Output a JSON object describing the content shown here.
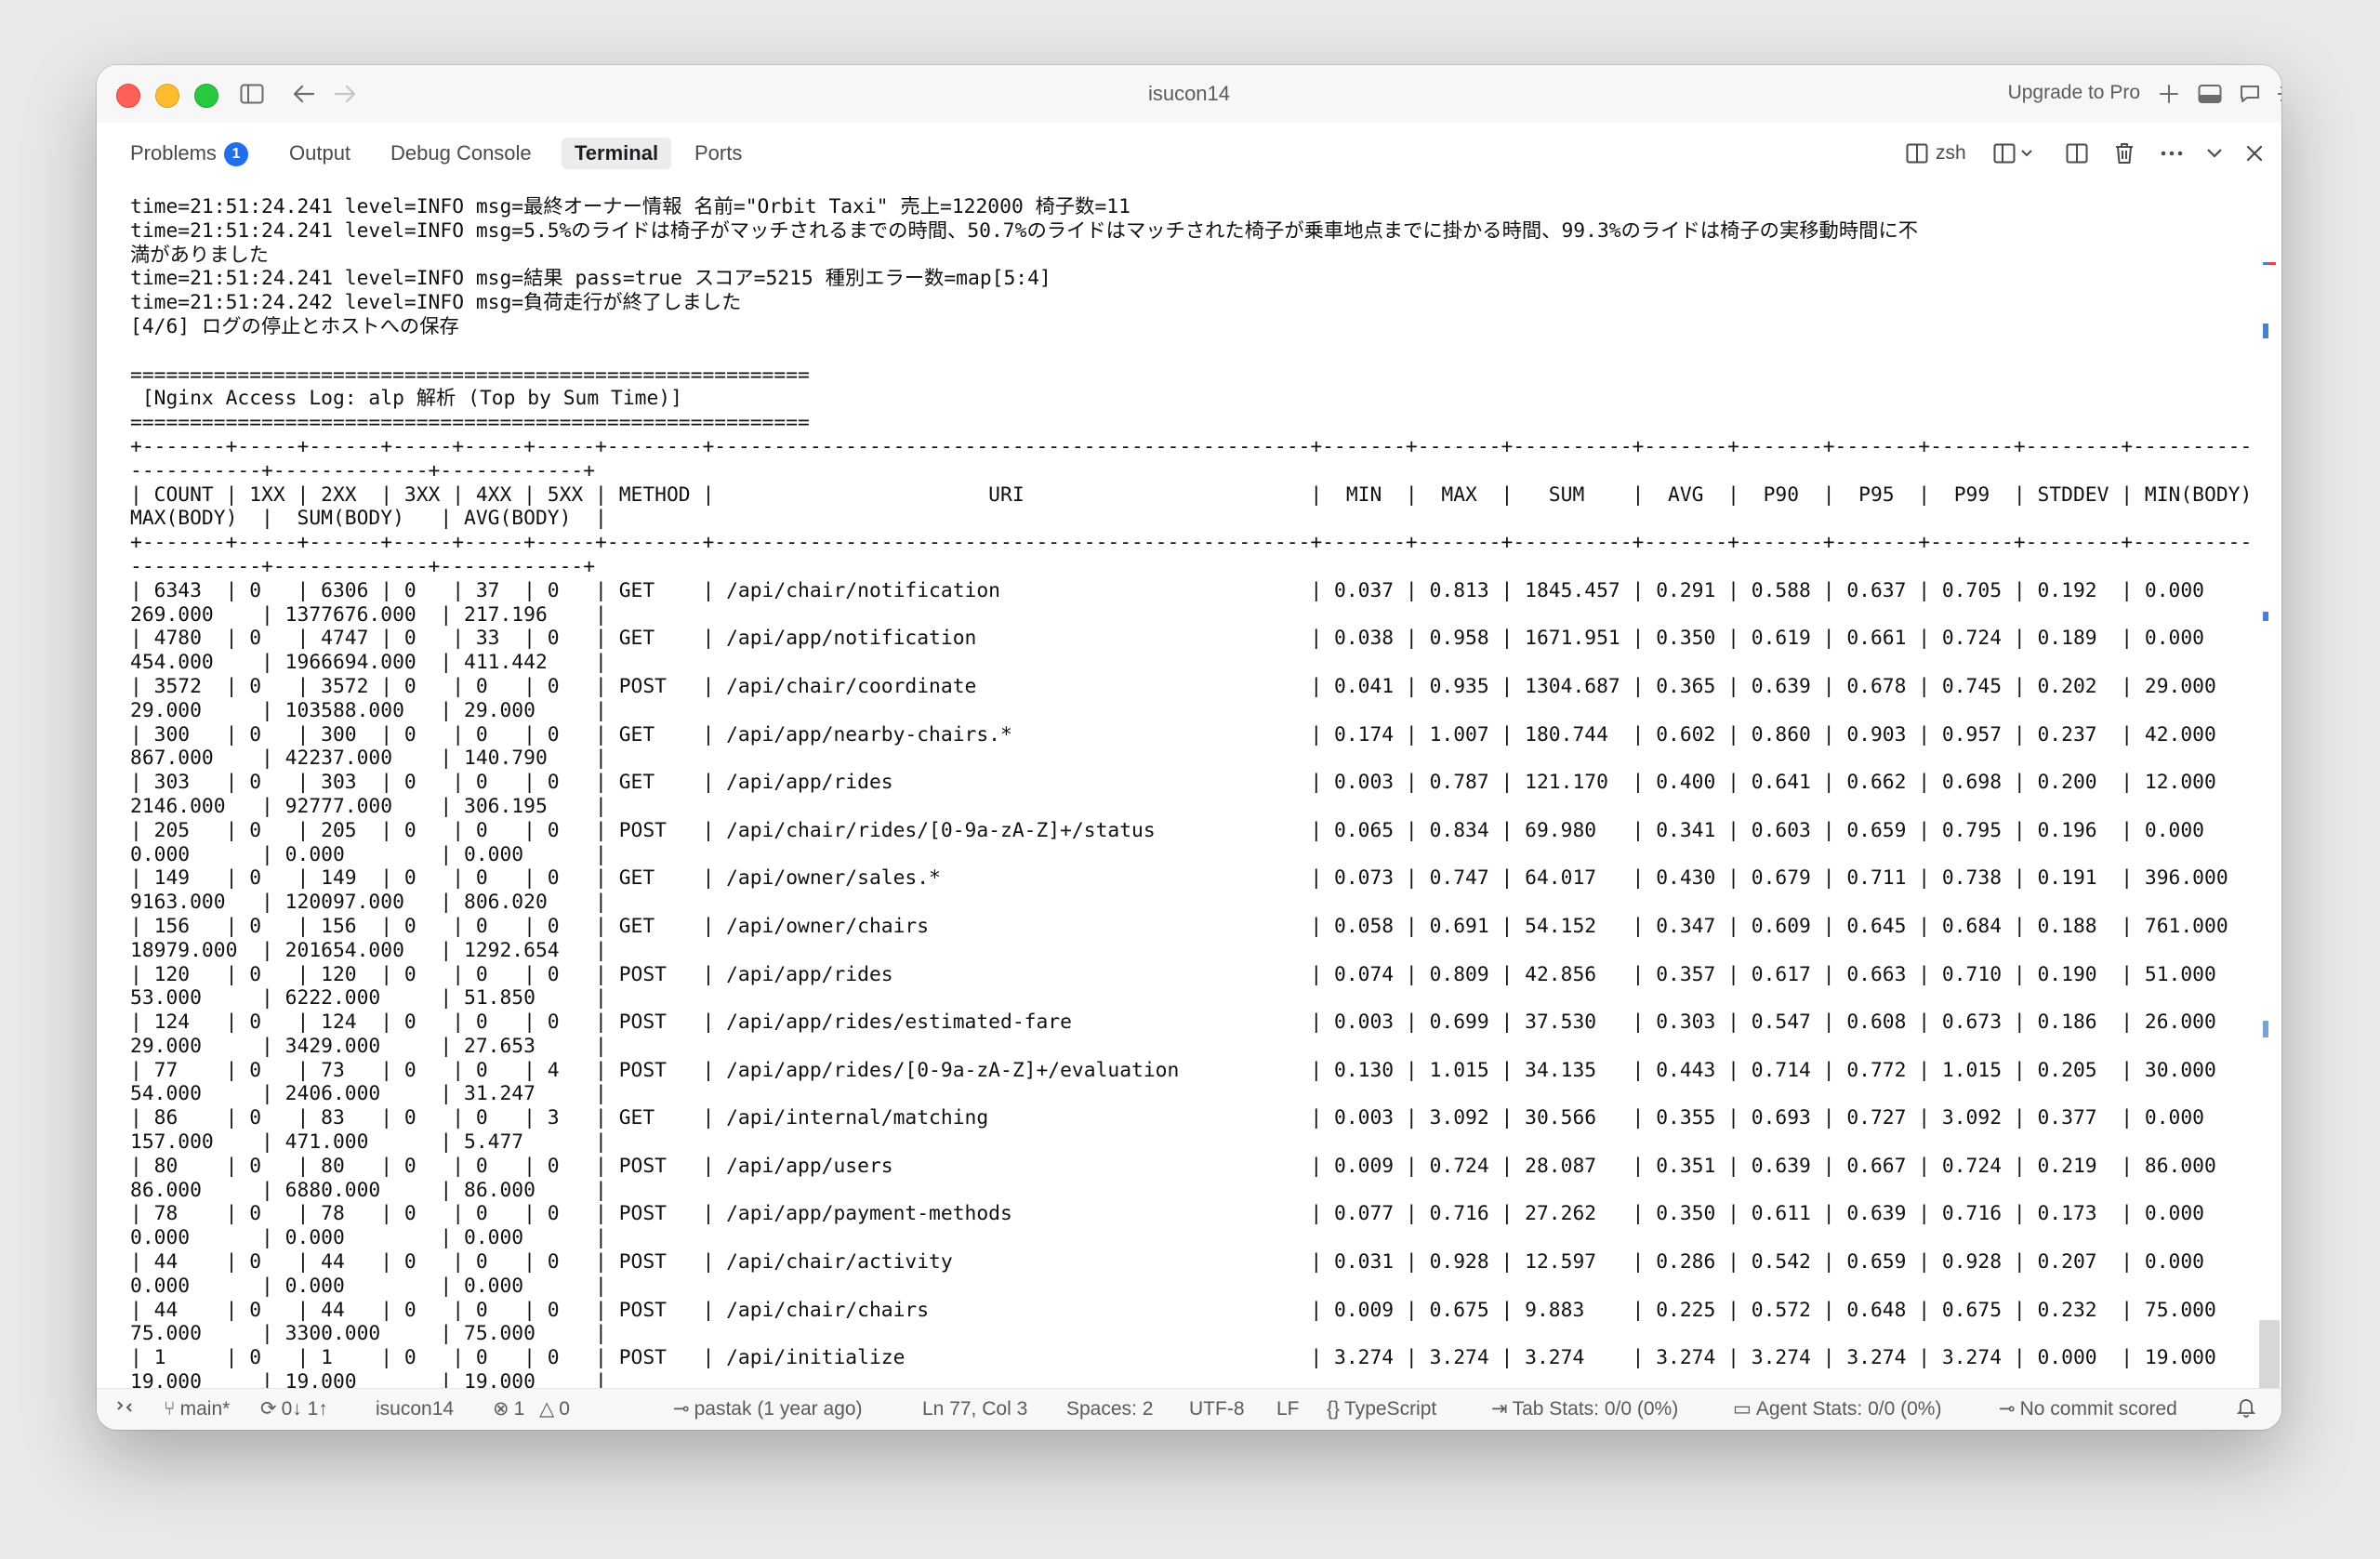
{
  "window": {
    "title": "isucon14",
    "upgrade_label": "Upgrade to Pro"
  },
  "panel": {
    "tabs": [
      {
        "label": "Problems",
        "badge": "1"
      },
      {
        "label": "Output"
      },
      {
        "label": "Debug Console"
      },
      {
        "label": "Terminal",
        "active": true
      },
      {
        "label": "Ports"
      }
    ],
    "shell_label": "zsh"
  },
  "terminal": {
    "lines": [
      "time=21:51:24.241 level=INFO msg=最終オーナー情報 名前=\"Orbit Taxi\" 売上=122000 椅子数=11",
      "time=21:51:24.241 level=INFO msg=5.5%のライドは椅子がマッチされるまでの時間、50.7%のライドはマッチされた椅子が乗車地点までに掛かる時間、99.3%のライドは椅子の実移動時間に不",
      "満がありました",
      "time=21:51:24.241 level=INFO msg=結果 pass=true スコア=5215 種別エラー数=map[5:4]",
      "time=21:51:24.242 level=INFO msg=負荷走行が終了しました",
      "[4/6] ログの停止とホストへの保存",
      "",
      "=========================================================",
      " [Nginx Access Log: alp 解析 (Top by Sum Time)]",
      "=========================================================",
      "+-------+-----+------+-----+-----+-----+--------+--------------------------------------------------+-------+-------+----------+-------+-------+-------+-------+--------+-----------+-",
      "-----------+-------------+------------+",
      "| COUNT | 1XX | 2XX  | 3XX | 4XX | 5XX | METHOD |                       URI                        |  MIN  |  MAX  |   SUM    |  AVG  |  P90  |  P95  |  P99  | STDDEV | MIN(BODY) |",
      "MAX(BODY)  |  SUM(BODY)   | AVG(BODY)  |",
      "+-------+-----+------+-----+-----+-----+--------+--------------------------------------------------+-------+-------+----------+-------+-------+-------+-------+--------+-----------+-",
      "-----------+-------------+------------+",
      "| 6343  | 0   | 6306 | 0   | 37  | 0   | GET    | /api/chair/notification                          | 0.037 | 0.813 | 1845.457 | 0.291 | 0.588 | 0.637 | 0.705 | 0.192  | 0.000     |",
      "269.000    | 1377676.000  | 217.196    |",
      "| 4780  | 0   | 4747 | 0   | 33  | 0   | GET    | /api/app/notification                            | 0.038 | 0.958 | 1671.951 | 0.350 | 0.619 | 0.661 | 0.724 | 0.189  | 0.000     |",
      "454.000    | 1966694.000  | 411.442    |",
      "| 3572  | 0   | 3572 | 0   | 0   | 0   | POST   | /api/chair/coordinate                            | 0.041 | 0.935 | 1304.687 | 0.365 | 0.639 | 0.678 | 0.745 | 0.202  | 29.000    |",
      "29.000     | 103588.000   | 29.000     |",
      "| 300   | 0   | 300  | 0   | 0   | 0   | GET    | /api/app/nearby-chairs.*                         | 0.174 | 1.007 | 180.744  | 0.602 | 0.860 | 0.903 | 0.957 | 0.237  | 42.000    |",
      "867.000    | 42237.000    | 140.790    |",
      "| 303   | 0   | 303  | 0   | 0   | 0   | GET    | /api/app/rides                                   | 0.003 | 0.787 | 121.170  | 0.400 | 0.641 | 0.662 | 0.698 | 0.200  | 12.000    |",
      "2146.000   | 92777.000    | 306.195    |",
      "| 205   | 0   | 205  | 0   | 0   | 0   | POST   | /api/chair/rides/[0-9a-zA-Z]+/status             | 0.065 | 0.834 | 69.980   | 0.341 | 0.603 | 0.659 | 0.795 | 0.196  | 0.000     |",
      "0.000      | 0.000        | 0.000      |",
      "| 149   | 0   | 149  | 0   | 0   | 0   | GET    | /api/owner/sales.*                               | 0.073 | 0.747 | 64.017   | 0.430 | 0.679 | 0.711 | 0.738 | 0.191  | 396.000   |",
      "9163.000   | 120097.000   | 806.020    |",
      "| 156   | 0   | 156  | 0   | 0   | 0   | GET    | /api/owner/chairs                                | 0.058 | 0.691 | 54.152   | 0.347 | 0.609 | 0.645 | 0.684 | 0.188  | 761.000   |",
      "18979.000  | 201654.000   | 1292.654   |",
      "| 120   | 0   | 120  | 0   | 0   | 0   | POST   | /api/app/rides                                   | 0.074 | 0.809 | 42.856   | 0.357 | 0.617 | 0.663 | 0.710 | 0.190  | 51.000    |",
      "53.000     | 6222.000     | 51.850     |",
      "| 124   | 0   | 124  | 0   | 0   | 0   | POST   | /api/app/rides/estimated-fare                    | 0.003 | 0.699 | 37.530   | 0.303 | 0.547 | 0.608 | 0.673 | 0.186  | 26.000    |",
      "29.000     | 3429.000     | 27.653     |",
      "| 77    | 0   | 73   | 0   | 0   | 4   | POST   | /api/app/rides/[0-9a-zA-Z]+/evaluation           | 0.130 | 1.015 | 34.135   | 0.443 | 0.714 | 0.772 | 1.015 | 0.205  | 30.000    |",
      "54.000     | 2406.000     | 31.247     |",
      "| 86    | 0   | 83   | 0   | 0   | 3   | GET    | /api/internal/matching                           | 0.003 | 3.092 | 30.566   | 0.355 | 0.693 | 0.727 | 3.092 | 0.377  | 0.000     |",
      "157.000    | 471.000      | 5.477      |",
      "| 80    | 0   | 80   | 0   | 0   | 0   | POST   | /api/app/users                                   | 0.009 | 0.724 | 28.087   | 0.351 | 0.639 | 0.667 | 0.724 | 0.219  | 86.000    |",
      "86.000     | 6880.000     | 86.000     |",
      "| 78    | 0   | 78   | 0   | 0   | 0   | POST   | /api/app/payment-methods                         | 0.077 | 0.716 | 27.262   | 0.350 | 0.611 | 0.639 | 0.716 | 0.173  | 0.000     |",
      "0.000      | 0.000        | 0.000      |",
      "| 44    | 0   | 44   | 0   | 0   | 0   | POST   | /api/chair/activity                              | 0.031 | 0.928 | 12.597   | 0.286 | 0.542 | 0.659 | 0.928 | 0.207  | 0.000     |",
      "0.000      | 0.000        | 0.000      |",
      "| 44    | 0   | 44   | 0   | 0   | 0   | POST   | /api/chair/chairs                                | 0.009 | 0.675 | 9.883    | 0.225 | 0.572 | 0.648 | 0.675 | 0.232  | 75.000    |",
      "75.000     | 3300.000     | 75.000     |",
      "| 1     | 0   | 1    | 0   | 0   | 0   | POST   | /api/initialize                                  | 3.274 | 3.274 | 3.274    | 3.274 | 3.274 | 3.274 | 3.274 | 0.000  | 19.000    |",
      "19.000     | 19.000       | 19.000     |"
    ]
  },
  "statusbar": {
    "branch": "main*",
    "sync": "0↓ 1↑",
    "workspace": "isucon14",
    "errors": "1",
    "warnings": "0",
    "blame": "pastak (1 year ago)",
    "cursor": "Ln 77, Col 3",
    "spaces": "Spaces: 2",
    "encoding": "UTF-8",
    "eol": "LF",
    "language": "TypeScript",
    "tab_stats": "Tab Stats: 0/0 (0%)",
    "agent_stats": "Agent Stats: 0/0 (0%)",
    "commit": "No commit scored"
  },
  "icons": [
    "sidebar-toggle-icon",
    "back-arrow-icon",
    "forward-arrow-icon",
    "plus-icon",
    "panel-icon",
    "chat-icon",
    "gear-icon",
    "terminal-split-icon",
    "layout-icon",
    "split-editor-icon",
    "trash-icon",
    "more-icon",
    "chevron-down-icon",
    "close-icon",
    "remote-icon",
    "branch-icon",
    "sync-icon",
    "error-icon",
    "warning-icon",
    "commit-icon",
    "bell-icon"
  ]
}
